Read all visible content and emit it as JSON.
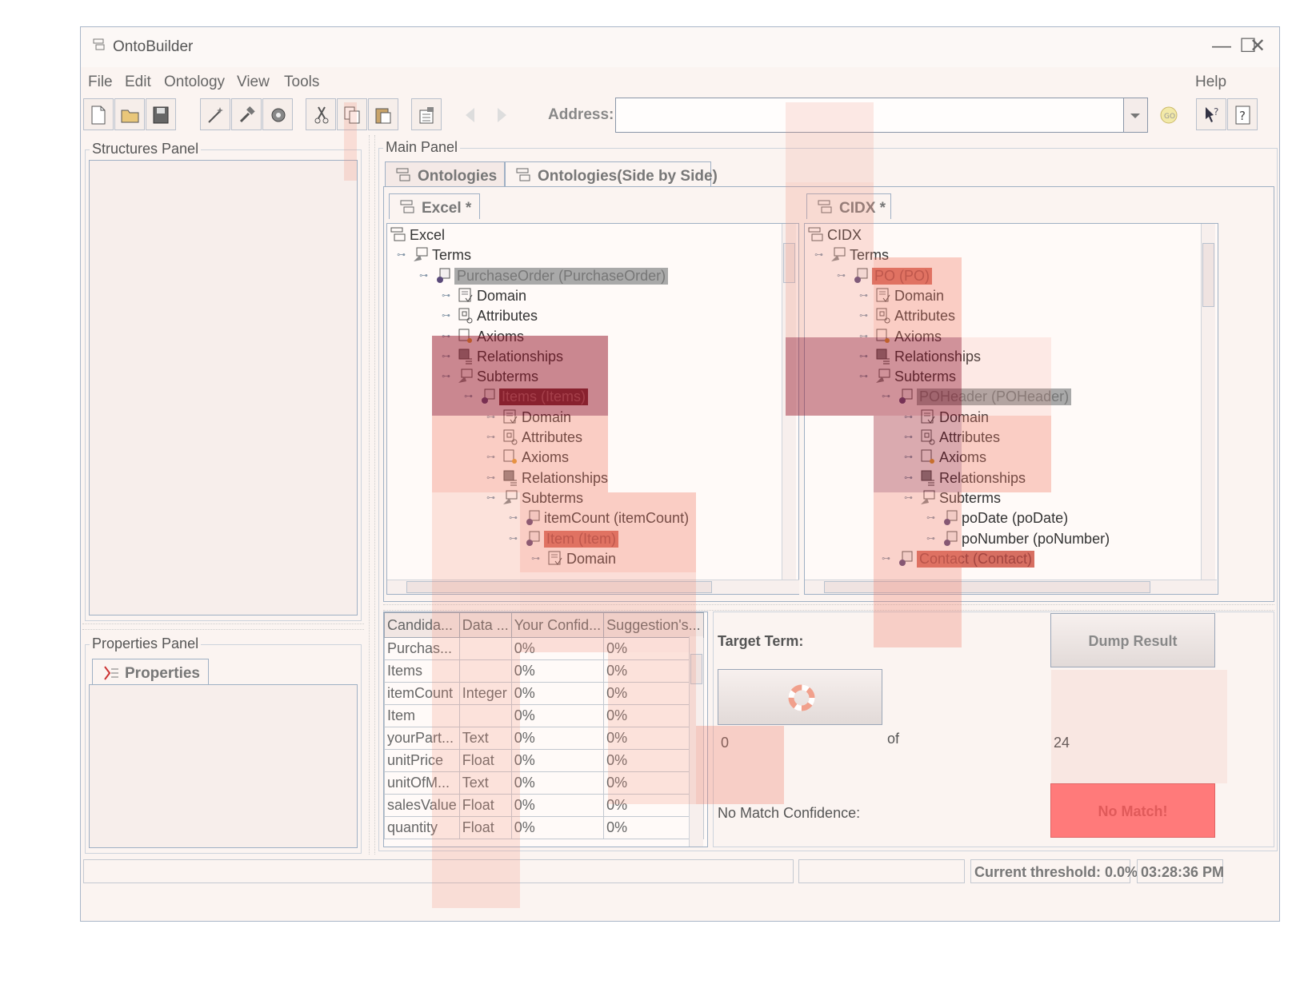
{
  "window": {
    "title": "OntoBuilder",
    "minimize": "—",
    "maximize": "☐",
    "close": "✕"
  },
  "menu": {
    "file": "File",
    "edit": "Edit",
    "ontology": "Ontology",
    "view": "View",
    "tools": "Tools",
    "help": "Help"
  },
  "toolbar": {
    "address_label": "Address:",
    "address_value": "",
    "icons": [
      "new-file-icon",
      "open-folder-icon",
      "save-icon",
      "wand-icon",
      "hammer-icon",
      "gear-icon",
      "cut-icon",
      "copy-icon",
      "paste-icon",
      "properties-icon",
      "back-arrow-icon",
      "forward-arrow-icon",
      "go-icon",
      "whats-this-icon",
      "help-icon"
    ]
  },
  "structures_panel": {
    "title": "Structures Panel"
  },
  "properties_panel": {
    "title": "Properties Panel",
    "tab": "Properties"
  },
  "main_panel": {
    "title": "Main Panel",
    "tabs": [
      "Ontologies",
      "Ontologies(Side by Side)"
    ],
    "left_ontology_tab": "Excel *",
    "right_ontology_tab": "CIDX *"
  },
  "left_tree": [
    {
      "label": "Excel",
      "depth": 0,
      "icon": "ontology-icon"
    },
    {
      "label": "Terms",
      "depth": 1,
      "icon": "terms-icon"
    },
    {
      "label": "PurchaseOrder (PurchaseOrder)",
      "depth": 2,
      "icon": "term-icon",
      "selected": "grey"
    },
    {
      "label": "Domain",
      "depth": 3,
      "icon": "domain-icon"
    },
    {
      "label": "Attributes",
      "depth": 3,
      "icon": "attributes-icon"
    },
    {
      "label": "Axioms",
      "depth": 3,
      "icon": "axioms-icon"
    },
    {
      "label": "Relationships",
      "depth": 3,
      "icon": "relationships-icon"
    },
    {
      "label": "Subterms",
      "depth": 3,
      "icon": "subterms-icon"
    },
    {
      "label": "Items (Items)",
      "depth": 4,
      "icon": "term-icon",
      "selected": "dark"
    },
    {
      "label": "Domain",
      "depth": 5,
      "icon": "domain-icon"
    },
    {
      "label": "Attributes",
      "depth": 5,
      "icon": "attributes-icon"
    },
    {
      "label": "Axioms",
      "depth": 5,
      "icon": "axioms-icon"
    },
    {
      "label": "Relationships",
      "depth": 5,
      "icon": "relationships-icon"
    },
    {
      "label": "Subterms",
      "depth": 5,
      "icon": "subterms-icon"
    },
    {
      "label": "itemCount (itemCount)",
      "depth": 6,
      "icon": "term-icon"
    },
    {
      "label": "Item (Item)",
      "depth": 6,
      "icon": "term-icon",
      "selected": "red"
    },
    {
      "label": "Domain",
      "depth": 7,
      "icon": "domain-icon"
    }
  ],
  "right_tree": [
    {
      "label": "CIDX",
      "depth": 0,
      "icon": "ontology-icon"
    },
    {
      "label": "Terms",
      "depth": 1,
      "icon": "terms-icon"
    },
    {
      "label": "PO (PO)",
      "depth": 2,
      "icon": "term-icon",
      "selected": "red"
    },
    {
      "label": "Domain",
      "depth": 3,
      "icon": "domain-icon"
    },
    {
      "label": "Attributes",
      "depth": 3,
      "icon": "attributes-icon"
    },
    {
      "label": "Axioms",
      "depth": 3,
      "icon": "axioms-icon"
    },
    {
      "label": "Relationships",
      "depth": 3,
      "icon": "relationships-icon"
    },
    {
      "label": "Subterms",
      "depth": 3,
      "icon": "subterms-icon"
    },
    {
      "label": "POHeader (POHeader)",
      "depth": 4,
      "icon": "term-icon",
      "selected": "grey"
    },
    {
      "label": "Domain",
      "depth": 5,
      "icon": "domain-icon"
    },
    {
      "label": "Attributes",
      "depth": 5,
      "icon": "attributes-icon"
    },
    {
      "label": "Axioms",
      "depth": 5,
      "icon": "axioms-icon"
    },
    {
      "label": "Relationships",
      "depth": 5,
      "icon": "relationships-icon"
    },
    {
      "label": "Subterms",
      "depth": 5,
      "icon": "subterms-icon"
    },
    {
      "label": "poDate (poDate)",
      "depth": 6,
      "icon": "term-icon"
    },
    {
      "label": "poNumber (poNumber)",
      "depth": 6,
      "icon": "term-icon"
    },
    {
      "label": "Contact (Contact)",
      "depth": 4,
      "icon": "term-icon",
      "selected": "red"
    }
  ],
  "candidates_table": {
    "headers": [
      "Candida...",
      "Data ...",
      "Your Confid...",
      "Suggestion's..."
    ],
    "rows": [
      [
        "Purchas...",
        "",
        "0%",
        "0%"
      ],
      [
        "Items",
        "",
        "0%",
        "0%"
      ],
      [
        "itemCount",
        "Integer",
        "0%",
        "0%"
      ],
      [
        "Item",
        "",
        "0%",
        "0%"
      ],
      [
        "yourPart...",
        "Text",
        "0%",
        "0%"
      ],
      [
        "unitPrice",
        "Float",
        "0%",
        "0%"
      ],
      [
        "unitOfM...",
        "Text",
        "0%",
        "0%"
      ],
      [
        "salesValue",
        "Float",
        "0%",
        "0%"
      ],
      [
        "quantity",
        "Float",
        "0%",
        "0%"
      ]
    ]
  },
  "matching": {
    "target_term_label": "Target Term:",
    "dump_result": "Dump Result",
    "current_index": "0",
    "of_label": "of",
    "total": "24",
    "no_match_confidence_label": "No Match Confidence:",
    "no_match_button": "No Match!",
    "no_match_color": "#ff7a7a"
  },
  "status": {
    "threshold": "Current threshold: 0.0%",
    "time": "03:28:36 PM"
  }
}
